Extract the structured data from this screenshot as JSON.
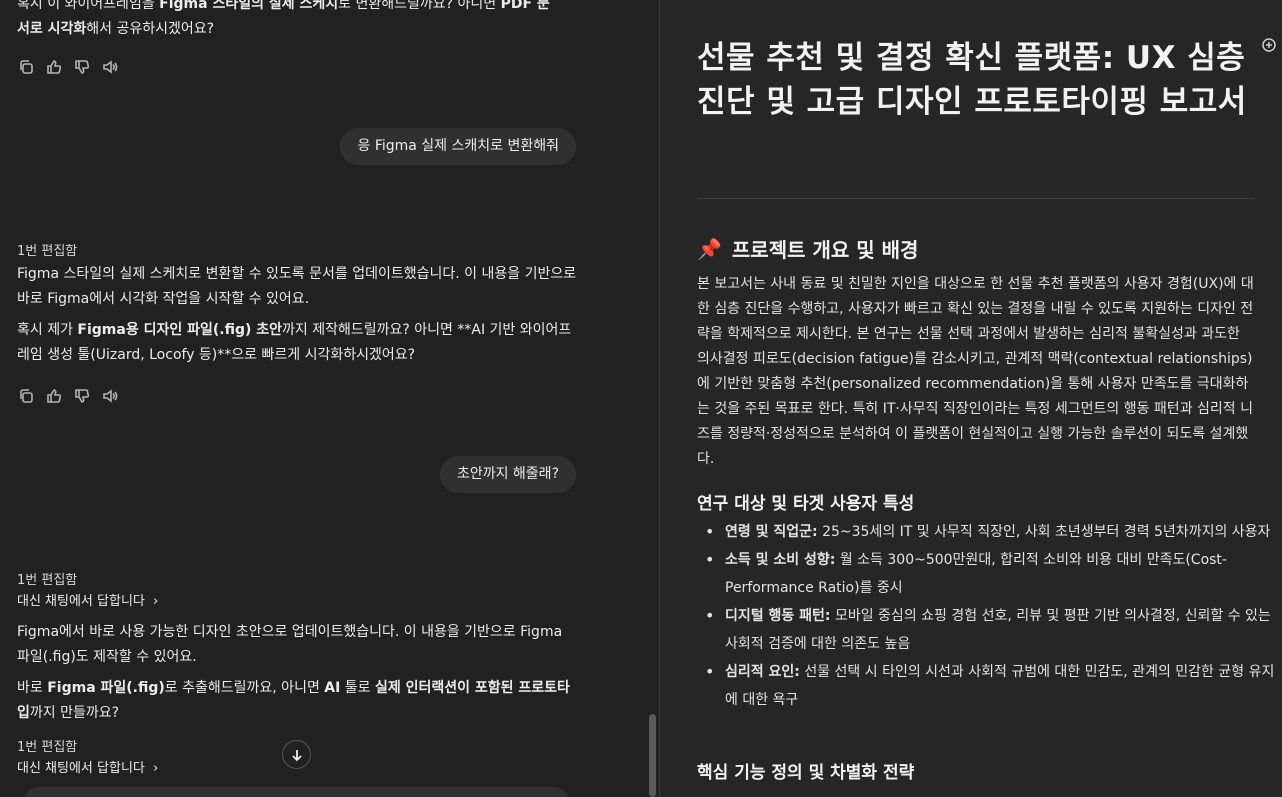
{
  "chat": {
    "msg0": {
      "line1_pre": "혹시 이 와이어프레임을 ",
      "line1_bold": "Figma 스타일의 실제 스케치",
      "line1_post": "로 변환해드릴까요? 아니면 ",
      "line1_bold2": "PDF 문",
      "line2_bold": "서로 시각화",
      "line2_post": "해서 공유하시겠어요?"
    },
    "user1": "응 Figma 실제 스캐치로 변환해줘",
    "msg1": {
      "edited": "1번 편집함",
      "p1": "Figma 스타일의 실제 스케치로 변환할 수 있도록 문서를 업데이트했습니다. 이 내용을 기반으로 바로 Figma에서 시각화 작업을 시작할 수 있어요.",
      "p2_pre": "혹시 제가 ",
      "p2_bold": "Figma용 디자인 파일(.fig) 초안",
      "p2_post": "까지 제작해드릴까요? 아니면 **AI 기반 와이어프레임 생성 툴(Uizard, Locofy 등)**으로 빠르게 시각화하시겠어요?"
    },
    "user2": "초안까지 해줄래?",
    "msg2": {
      "edited": "1번 편집함",
      "reply_link": "대신 채팅에서 답합니다",
      "p1": "Figma에서 바로 사용 가능한 디자인 초안으로 업데이트했습니다. 이 내용을 기반으로 Figma 파일(.fig)도 제작할 수 있어요.",
      "p2_pre": "바로 ",
      "p2_bold1": "Figma 파일(.fig)",
      "p2_mid": "로 추출해드릴까요, 아니면 ",
      "p2_bold2": "AI",
      "p2_mid2": " 툴로 ",
      "p2_bold3": "실제 인터랙션이 포함된 프로토타입",
      "p2_post": "까지 만들까요?"
    },
    "msg3": {
      "edited": "1번 편집함",
      "reply_link": "대신 채팅에서 답합니다"
    },
    "icons": [
      "copy-icon",
      "thumbs-up-icon",
      "thumbs-down-icon",
      "speaker-icon"
    ]
  },
  "doc": {
    "title": "선물 추천 및 결정 확신 플랫폼: UX 심층 진단 및 고급 디자인 프로토타이핑 보고서",
    "section1": {
      "icon": "📌",
      "heading": "프로젝트 개요 및 배경",
      "body": "본 보고서는 사내 동료 및 친밀한 지인을 대상으로 한 선물 추천 플랫폼의 사용자 경험(UX)에 대한 심층 진단을 수행하고, 사용자가 빠르고 확신 있는 결정을 내릴 수 있도록 지원하는 디자인 전략을 학제적으로 제시한다. 본 연구는 선물 선택 과정에서 발생하는 심리적 불확실성과 과도한 의사결정 피로도(decision fatigue)를 감소시키고, 관계적 맥락(contextual relationships)에 기반한 맞춤형 추천(personalized recommendation)을 통해 사용자 만족도를 극대화하는 것을 주된 목표로 한다. 특히 IT·사무직 직장인이라는 특정 세그먼트의 행동 패턴과 심리적 니즈를 정량적·정성적으로 분석하여 이 플랫폼이 현실적이고 실행 가능한 솔루션이 되도록 설계했다."
    },
    "section2": {
      "heading": "연구 대상 및 타겟 사용자 특성",
      "items": [
        {
          "label": "연령 및 직업군:",
          "text": " 25~35세의 IT 및 사무직 직장인, 사회 초년생부터 경력 5년차까지의 사용자"
        },
        {
          "label": "소득 및 소비 성향:",
          "text": " 월 소득 300~500만원대, 합리적 소비와 비용 대비 만족도(Cost-Performance Ratio)를 중시"
        },
        {
          "label": "디지털 행동 패턴:",
          "text": " 모바일 중심의 쇼핑 경험 선호, 리뷰 및 평판 기반 의사결정, 신뢰할 수 있는 사회적 검증에 대한 의존도 높음"
        },
        {
          "label": "심리적 요인:",
          "text": " 선물 선택 시 타인의 시선과 사회적 규범에 대한 민감도, 관계의 민감한 균형 유지에 대한 욕구"
        }
      ]
    },
    "section3": {
      "heading": "핵심 기능 정의 및 차별화 전략"
    }
  }
}
